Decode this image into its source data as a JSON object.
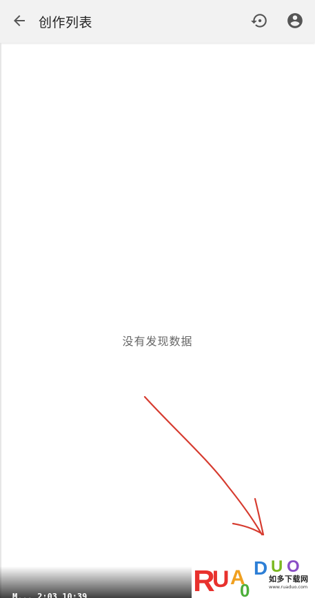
{
  "header": {
    "title": "创作列表"
  },
  "main": {
    "empty_message": "没有发现数据"
  },
  "watermark": {
    "brand": "RUANDUO",
    "tagline": "如多下载网",
    "url": "www.ruaduo.com"
  },
  "bottom_bar": {
    "partial_text": "M... 2:03 10:39"
  },
  "colors": {
    "appbar_bg": "#f2f2f2",
    "arrow_red": "#d63b2f",
    "text_primary": "#222222",
    "text_secondary": "#666666"
  },
  "icons": {
    "back": "arrow-back-icon",
    "history": "history-icon",
    "account": "account-circle-icon"
  }
}
